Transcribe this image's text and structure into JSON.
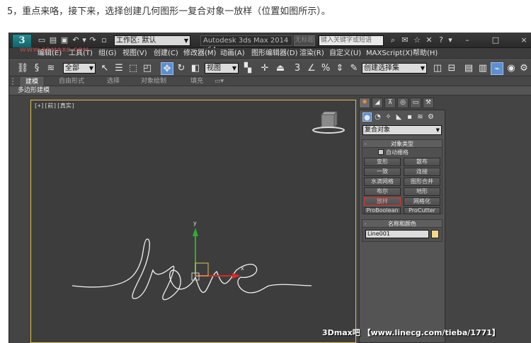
{
  "caption": "5，重点来咯，接下来，选择创建几何图形一复合对象一放样（位置如图所示）。",
  "app": {
    "logo_text": "3",
    "workspace": "工作区: 默认",
    "window_title": "Autodesk 3ds Max 2014 x64",
    "title_extra": "无标题",
    "search_placeholder": "键入关键字或短语"
  },
  "menu": [
    "编辑(E)",
    "工具(T)",
    "组(G)",
    "视图(V)",
    "创建(C)",
    "修改器(M)",
    "动画(A)",
    "图形编辑器(D)",
    "渲染(R)",
    "自定义(U)",
    "MAXScript(X)",
    "帮助(H)"
  ],
  "toolbar": {
    "selection_filter": "全部",
    "reference_coord": "视图",
    "named_selection": "创建选择集",
    "snap_label": "3"
  },
  "ribbon": {
    "tabs": [
      "建模",
      "自由形式",
      "选择",
      "对象绘制",
      "填充"
    ],
    "active_tab": "建模",
    "sub_label": "多边形建模"
  },
  "viewport": {
    "label": "[+][前][真实]",
    "axis_y": "y",
    "axis_x": "x"
  },
  "command_panel": {
    "category": "复合对象",
    "object_type": {
      "header": "对象类型",
      "autogrid": "自动栅格",
      "buttons": [
        "变形",
        "散布",
        "一致",
        "连接",
        "水滴网格",
        "图形合并",
        "布尔",
        "地形",
        "放样",
        "网格化",
        "ProBoolean",
        "ProCutter"
      ],
      "highlighted": "放样"
    },
    "name_color": {
      "header": "名称和颜色",
      "name": "Line001",
      "swatch_color": "#f5d78a"
    }
  },
  "watermarks": {
    "top": "WWW.3DMAX8.COM",
    "footer": "3Dmax吧 【www.linecg.com/tieba/1771】"
  }
}
